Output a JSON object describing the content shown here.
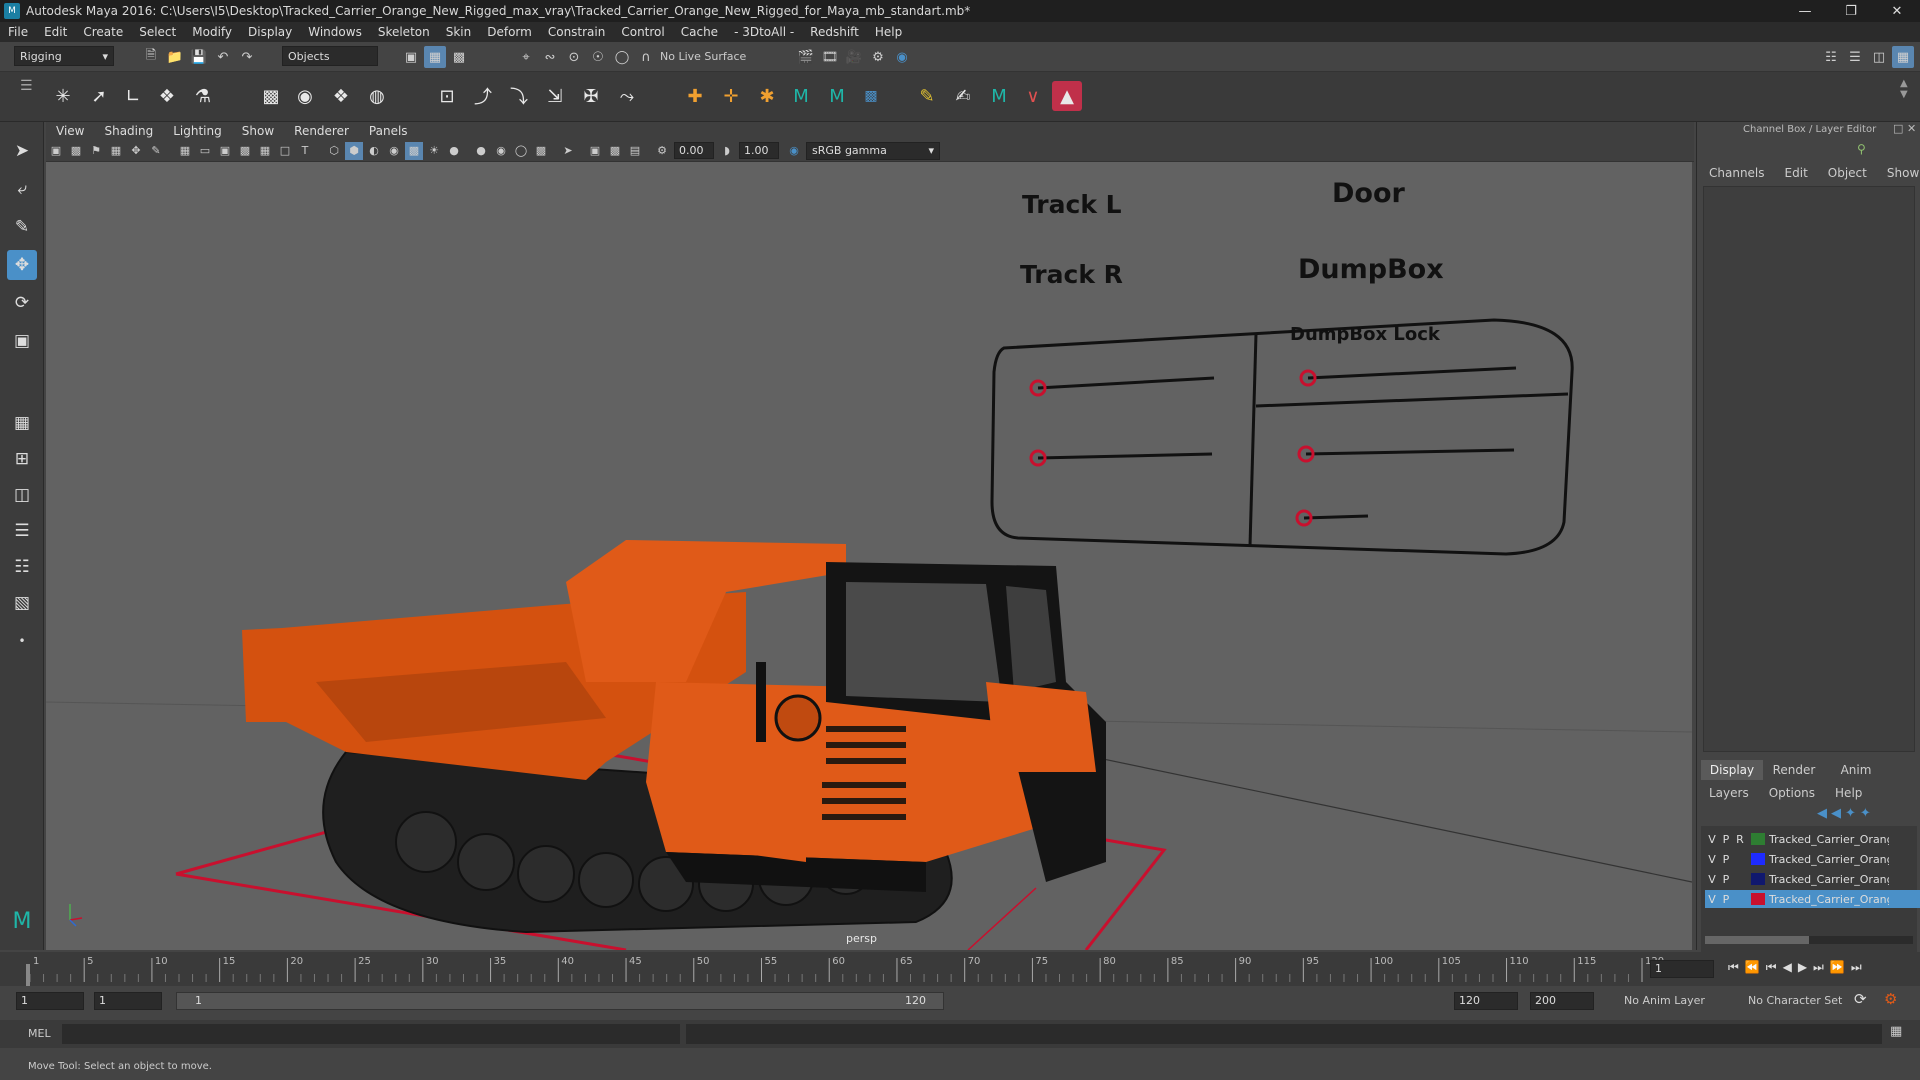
{
  "window": {
    "title": "Autodesk Maya 2016: C:\\Users\\I5\\Desktop\\Tracked_Carrier_Orange_New_Rigged_max_vray\\Tracked_Carrier_Orange_New_Rigged_for_Maya_mb_standart.mb*"
  },
  "menu": [
    "File",
    "Edit",
    "Create",
    "Select",
    "Modify",
    "Display",
    "Windows",
    "Skeleton",
    "Skin",
    "Deform",
    "Constrain",
    "Control",
    "Cache",
    "- 3DtoAll -",
    "Redshift",
    "Help"
  ],
  "status": {
    "mode": "Rigging",
    "select_mode": "Objects",
    "live_surface": "No Live Surface"
  },
  "viewport_menu": [
    "View",
    "Shading",
    "Lighting",
    "Show",
    "Renderer",
    "Panels"
  ],
  "viewport_toolbar": {
    "exposure": "0.00",
    "gamma": "1.00",
    "color_space": "sRGB gamma"
  },
  "viewport": {
    "camera": "persp",
    "controls": {
      "track_l": "Track L",
      "track_r": "Track R",
      "door": "Door",
      "dumpbox": "DumpBox",
      "dumpbox_lock": "DumpBox Lock"
    }
  },
  "channel_box": {
    "header": "Channel Box / Layer Editor",
    "menu": [
      "Channels",
      "Edit",
      "Object",
      "Show"
    ]
  },
  "layer_editor": {
    "tabs": [
      "Display",
      "Render",
      "Anim"
    ],
    "menu": [
      "Layers",
      "Options",
      "Help"
    ],
    "layers": [
      {
        "v": "V",
        "p": "P",
        "r": "R",
        "name": "Tracked_Carrier_Orange_New",
        "color": "#2e7d32"
      },
      {
        "v": "V",
        "p": "P",
        "r": "",
        "name": "Tracked_Carrier_Orange",
        "color": "#1e2bff"
      },
      {
        "v": "V",
        "p": "P",
        "r": "",
        "name": "Tracked_Carrier_Orange",
        "color": "#10186e"
      },
      {
        "v": "V",
        "p": "P",
        "r": "",
        "name": "Tracked_Carrier_Orange",
        "color": "#c8102e"
      }
    ]
  },
  "timeline": {
    "ticks": [
      "1",
      "5",
      "10",
      "15",
      "20",
      "25",
      "30",
      "35",
      "40",
      "45",
      "50",
      "55",
      "60",
      "65",
      "70",
      "75",
      "80",
      "85",
      "90",
      "95",
      "100",
      "105",
      "110",
      "115",
      "120"
    ],
    "current_frame": "1"
  },
  "range": {
    "start": "1",
    "playback_start": "1",
    "slider_start": "1",
    "slider_end": "120",
    "playback_end": "120",
    "end": "200",
    "anim_layer": "No Anim Layer",
    "character_set": "No Character Set"
  },
  "mel_label": "MEL",
  "help_text": "Move Tool: Select an object to move.",
  "colors": {
    "accent": "#4a90c8",
    "truck_orange": "#e05a18",
    "ground_line": "#c8102e"
  }
}
